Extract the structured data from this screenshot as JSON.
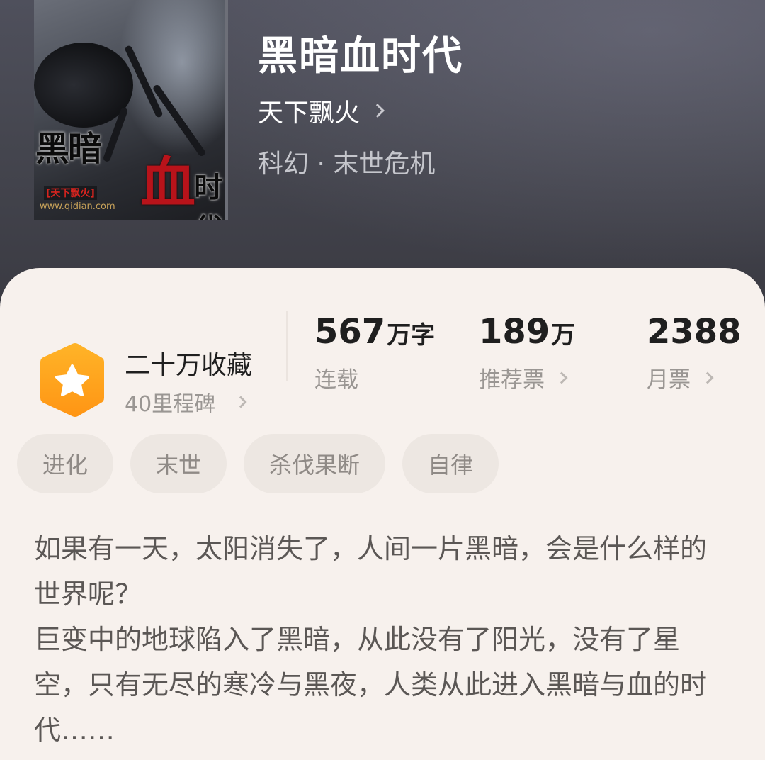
{
  "book": {
    "title": "黑暗血时代",
    "author": "天下飘火",
    "genre": "科幻 · 末世危机",
    "cover": {
      "title_a": "黑暗",
      "title_b": "血",
      "title_c": "时代",
      "author_tag": "[天下飘火]",
      "site": "www.qidian.com"
    }
  },
  "collection": {
    "label": "二十万收藏",
    "milestone": "40里程碑"
  },
  "stats": [
    {
      "value": "567",
      "unit": "万字",
      "label": "连载"
    },
    {
      "value": "189",
      "unit": "万",
      "label": "推荐票"
    },
    {
      "value": "2388",
      "unit": "",
      "label": "月票"
    }
  ],
  "tags": [
    "进化",
    "末世",
    "杀伐果断",
    "自律"
  ],
  "description": [
    "如果有一天，太阳消失了，人间一片黑暗，会是什么样的世界呢？",
    "巨变中的地球陷入了黑暗，从此没有了阳光，没有了星空，只有无尽的寒冷与黑夜，人类从此进入黑暗与血的时代……"
  ],
  "colors": {
    "hero_bg": "#45464f",
    "card_bg": "#f7f1ed",
    "badge_orange": "#ffa51f",
    "tag_bg": "#ede7e2"
  }
}
